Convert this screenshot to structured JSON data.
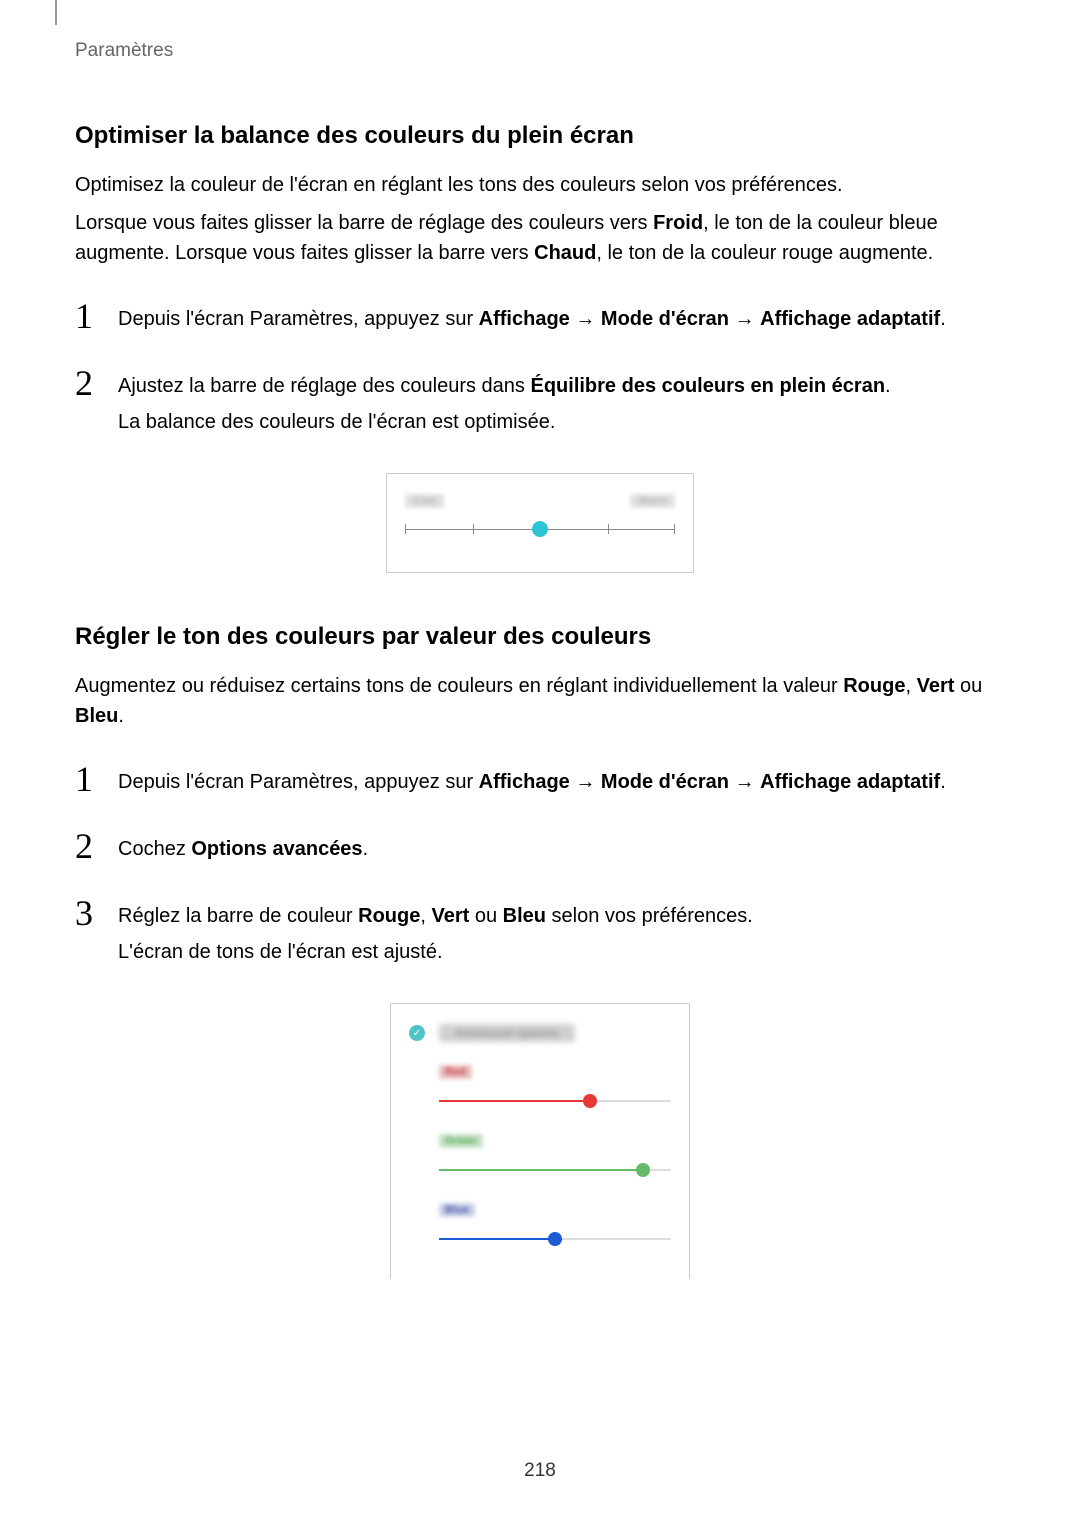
{
  "breadcrumb": "Paramètres",
  "section1": {
    "title": "Optimiser la balance des couleurs du plein écran",
    "para1": "Optimisez la couleur de l'écran en réglant les tons des couleurs selon vos préférences.",
    "para2a": "Lorsque vous faites glisser la barre de réglage des couleurs vers ",
    "para2b": "Froid",
    "para2c": ", le ton de la couleur bleue augmente. Lorsque vous faites glisser la barre vers ",
    "para2d": "Chaud",
    "para2e": ", le ton de la couleur rouge augmente.",
    "step1a": "Depuis l'écran Paramètres, appuyez sur ",
    "step1b": "Affichage",
    "step1arrow1": " → ",
    "step1c": "Mode d'écran",
    "step1arrow2": " → ",
    "step1d": "Affichage adaptatif",
    "step1e": ".",
    "step2a": "Ajustez la barre de réglage des couleurs dans ",
    "step2b": "Équilibre des couleurs en plein écran",
    "step2c": ".",
    "step2d": "La balance des couleurs de l'écran est optimisée."
  },
  "figure1": {
    "leftLabel": "Cool",
    "rightLabel": "Warm"
  },
  "section2": {
    "title": "Régler le ton des couleurs par valeur des couleurs",
    "para1a": "Augmentez ou réduisez certains tons de couleurs en réglant individuellement la valeur ",
    "para1b": "Rouge",
    "para1c": ", ",
    "para1d": "Vert",
    "para1e": " ou ",
    "para1f": "Bleu",
    "para1g": ".",
    "step1a": "Depuis l'écran Paramètres, appuyez sur ",
    "step1b": "Affichage",
    "step1arrow1": " → ",
    "step1c": "Mode d'écran",
    "step1arrow2": " → ",
    "step1d": "Affichage adaptatif",
    "step1e": ".",
    "step2a": "Cochez ",
    "step2b": "Options avancées",
    "step2c": ".",
    "step3a": "Réglez la barre de couleur ",
    "step3b": "Rouge",
    "step3c": ", ",
    "step3d": "Vert",
    "step3e": " ou ",
    "step3f": "Bleu",
    "step3g": " selon vos préférences.",
    "step3h": "L'écran de tons de l'écran est ajusté."
  },
  "figure2": {
    "title": "Advanced options",
    "red": "Red",
    "green": "Green",
    "blue": "Blue"
  },
  "steps": {
    "n1": "1",
    "n2": "2",
    "n3": "3"
  },
  "pageNumber": "218"
}
